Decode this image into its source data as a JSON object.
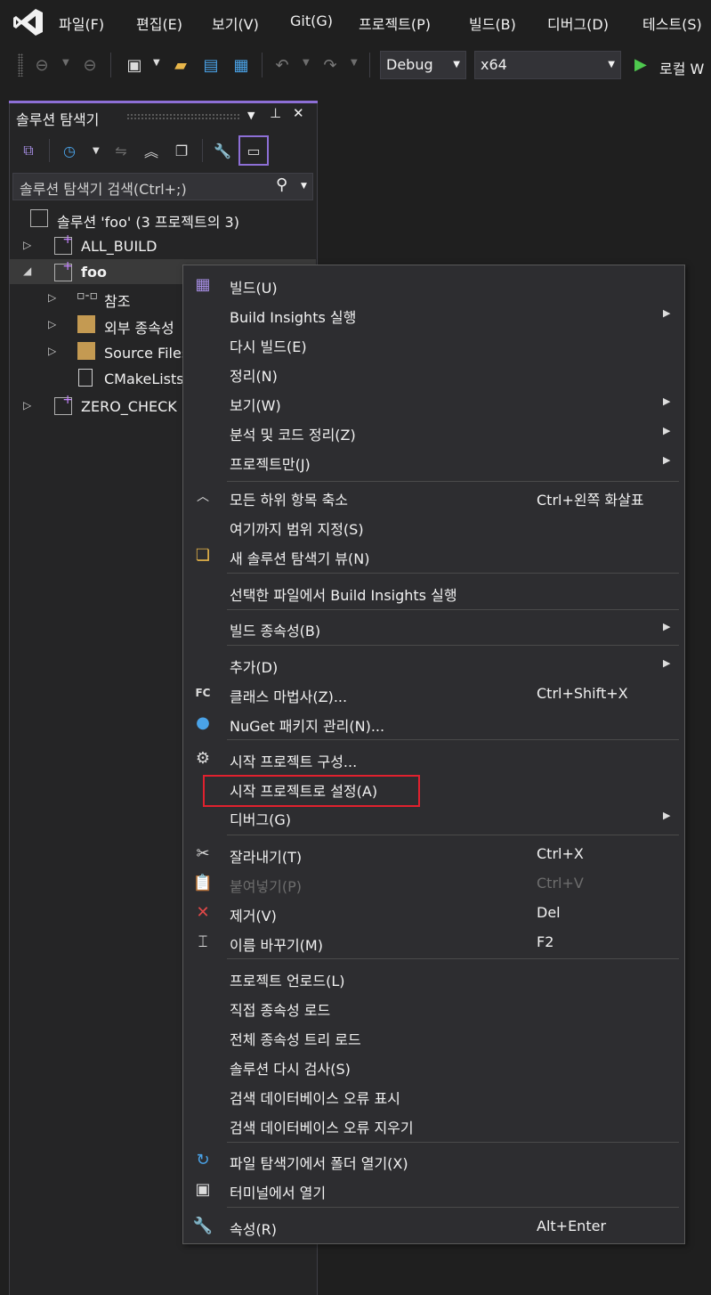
{
  "menubar": {
    "items": [
      "파일(F)",
      "편집(E)",
      "보기(V)",
      "Git(G)",
      "프로젝트(P)",
      "빌드(B)",
      "디버그(D)",
      "테스트(S)"
    ]
  },
  "toolbar": {
    "config": "Debug",
    "platform": "x64",
    "run_label": "로컬 W"
  },
  "solution_explorer": {
    "title": "솔루션 탐색기",
    "search_placeholder": "솔루션 탐색기 검색(Ctrl+;)",
    "tree": {
      "solution": "솔루션 'foo'  (3 프로젝트의 3)",
      "all_build": "ALL_BUILD",
      "foo": "foo",
      "references": "참조",
      "external_deps": "외부 종속성",
      "source_files": "Source Files",
      "cmakelists": "CMakeLists",
      "zero_check": "ZERO_CHECK"
    }
  },
  "context_menu": {
    "items": [
      {
        "label": "빌드(U)",
        "shortcut": ""
      },
      {
        "label": "Build Insights 실행",
        "shortcut": ""
      },
      {
        "label": "다시 빌드(E)",
        "shortcut": ""
      },
      {
        "label": "정리(N)",
        "shortcut": ""
      },
      {
        "label": "보기(W)",
        "shortcut": ""
      },
      {
        "label": "분석 및 코드 정리(Z)",
        "shortcut": ""
      },
      {
        "label": "프로젝트만(J)",
        "shortcut": ""
      },
      {
        "label": "모든 하위 항목 축소",
        "shortcut": "Ctrl+왼쪽 화살표"
      },
      {
        "label": "여기까지 범위 지정(S)",
        "shortcut": ""
      },
      {
        "label": "새 솔루션 탐색기 뷰(N)",
        "shortcut": ""
      },
      {
        "label": "선택한 파일에서 Build Insights 실행",
        "shortcut": ""
      },
      {
        "label": "빌드 종속성(B)",
        "shortcut": ""
      },
      {
        "label": "추가(D)",
        "shortcut": ""
      },
      {
        "label": "클래스 마법사(Z)...",
        "shortcut": "Ctrl+Shift+X"
      },
      {
        "label": "NuGet 패키지 관리(N)...",
        "shortcut": ""
      },
      {
        "label": "시작 프로젝트 구성...",
        "shortcut": ""
      },
      {
        "label": "시작 프로젝트로 설정(A)",
        "shortcut": ""
      },
      {
        "label": "디버그(G)",
        "shortcut": ""
      },
      {
        "label": "잘라내기(T)",
        "shortcut": "Ctrl+X"
      },
      {
        "label": "붙여넣기(P)",
        "shortcut": "Ctrl+V"
      },
      {
        "label": "제거(V)",
        "shortcut": "Del"
      },
      {
        "label": "이름 바꾸기(M)",
        "shortcut": "F2"
      },
      {
        "label": "프로젝트 언로드(L)",
        "shortcut": ""
      },
      {
        "label": "직접 종속성 로드",
        "shortcut": ""
      },
      {
        "label": "전체 종속성 트리 로드",
        "shortcut": ""
      },
      {
        "label": "솔루션 다시 검사(S)",
        "shortcut": ""
      },
      {
        "label": "검색 데이터베이스 오류 표시",
        "shortcut": ""
      },
      {
        "label": "검색 데이터베이스 오류 지우기",
        "shortcut": ""
      },
      {
        "label": "파일 탐색기에서 폴더 열기(X)",
        "shortcut": ""
      },
      {
        "label": "터미널에서 열기",
        "shortcut": ""
      },
      {
        "label": "속성(R)",
        "shortcut": "Alt+Enter"
      }
    ]
  },
  "colors": {
    "accent": "#8d6fd6",
    "highlight_box": "#e0212e",
    "run_green": "#4ec94e",
    "menu_bg": "#2d2d30"
  }
}
